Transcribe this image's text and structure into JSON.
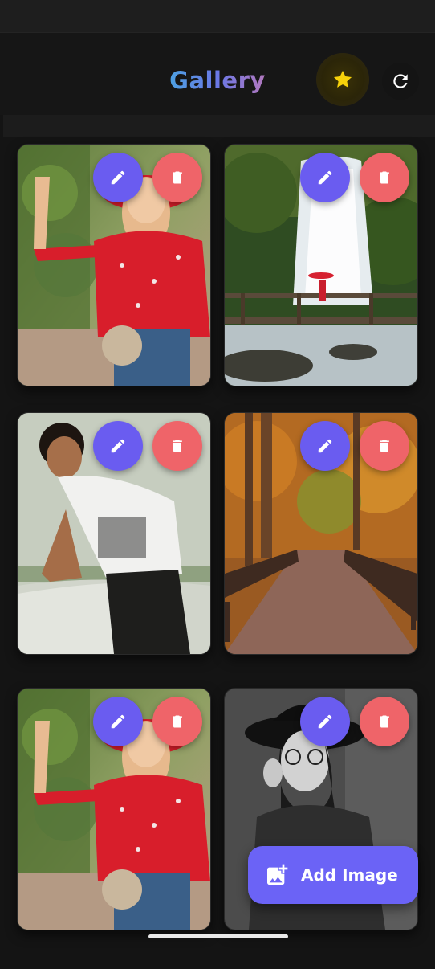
{
  "app": {
    "title": "Gallery",
    "icons": {
      "favorite": "star-icon",
      "refresh": "refresh-icon",
      "edit": "pencil-icon",
      "delete": "trash-icon",
      "add": "add-photo-icon"
    },
    "colors": {
      "background": "#141414",
      "edit_button": "#6a5cf0",
      "delete_button": "#ef6469",
      "fab": "#6b63f6",
      "star": "#f6d10a"
    }
  },
  "gallery": {
    "images": [
      {
        "subject": "woman in red blouse"
      },
      {
        "subject": "waterfall with bridge"
      },
      {
        "subject": "man in white t-shirt"
      },
      {
        "subject": "autumn forest boardwalk"
      },
      {
        "subject": "woman in red blouse"
      },
      {
        "subject": "woman in black hat (black and white)"
      }
    ]
  },
  "fab": {
    "label": "Add Image"
  }
}
